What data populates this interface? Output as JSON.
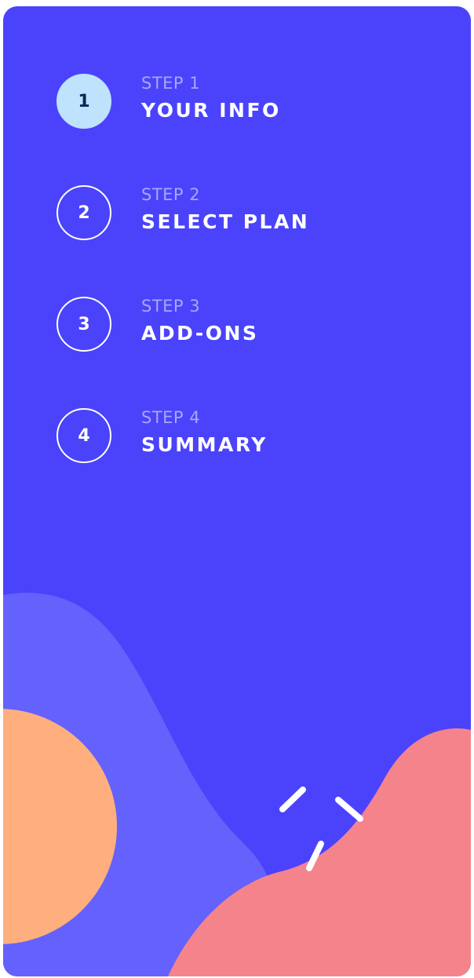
{
  "sidebar": {
    "colors": {
      "background": "#4a43fb",
      "active_circle": "#bfe2fd",
      "wave": "#6461fc",
      "orange_circle": "#ffaf7e",
      "pink_blob": "#f5838c",
      "kicker_text": "#aaa6fd"
    },
    "steps": [
      {
        "number": "1",
        "kicker": "STEP 1",
        "title": "YOUR INFO",
        "active": true
      },
      {
        "number": "2",
        "kicker": "STEP 2",
        "title": "SELECT PLAN",
        "active": false
      },
      {
        "number": "3",
        "kicker": "STEP 3",
        "title": "ADD-ONS",
        "active": false
      },
      {
        "number": "4",
        "kicker": "STEP 4",
        "title": "SUMMARY",
        "active": false
      }
    ]
  }
}
